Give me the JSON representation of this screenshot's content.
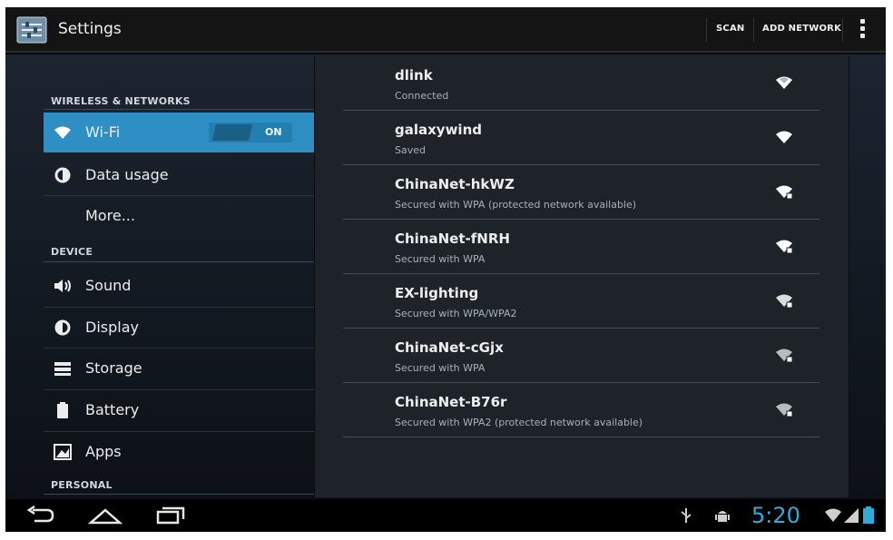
{
  "action_bar": {
    "title": "Settings",
    "scan_label": "SCAN",
    "add_network_label": "ADD NETWORK",
    "app_icon": "settings-app-icon",
    "overflow_icon": "overflow-menu-icon"
  },
  "sidebar": {
    "sections": [
      {
        "label": "WIRELESS & NETWORKS"
      },
      {
        "label": "DEVICE"
      },
      {
        "label": "PERSONAL"
      }
    ],
    "items": [
      {
        "label": "Wi-Fi",
        "icon": "wifi-icon",
        "selected": true
      },
      {
        "label": "Data usage",
        "icon": "data-usage-icon"
      },
      {
        "label": "More...",
        "icon": ""
      },
      {
        "label": "Sound",
        "icon": "speaker-icon"
      },
      {
        "label": "Display",
        "icon": "brightness-icon"
      },
      {
        "label": "Storage",
        "icon": "storage-icon"
      },
      {
        "label": "Battery",
        "icon": "battery-icon"
      },
      {
        "label": "Apps",
        "icon": "apps-icon"
      }
    ],
    "wifi_toggle": {
      "label": "ON",
      "state": "on"
    }
  },
  "networks": [
    {
      "name": "dlink",
      "status": "Connected",
      "secured": false
    },
    {
      "name": "galaxywind",
      "status": "Saved",
      "secured": false
    },
    {
      "name": "ChinaNet-hkWZ",
      "status": "Secured with WPA (protected network available)",
      "secured": true
    },
    {
      "name": "ChinaNet-fNRH",
      "status": "Secured with WPA",
      "secured": true
    },
    {
      "name": "EX-lighting",
      "status": "Secured with WPA/WPA2",
      "secured": true
    },
    {
      "name": "ChinaNet-cGjx",
      "status": "Secured with WPA",
      "secured": true
    },
    {
      "name": "ChinaNet-B76r",
      "status": "Secured with WPA2 (protected network available)",
      "secured": true
    }
  ],
  "nav_bar": {
    "back_icon": "back-icon",
    "home_icon": "home-icon",
    "recents_icon": "recent-apps-icon"
  },
  "status_bar": {
    "time": "5:20",
    "icons": [
      "usb-icon",
      "android-debug-icon",
      "wifi-status-icon",
      "signal-icon",
      "battery-status-icon"
    ]
  },
  "colors": {
    "accent": "#33a9d8",
    "selected": "#2e8fc4"
  }
}
